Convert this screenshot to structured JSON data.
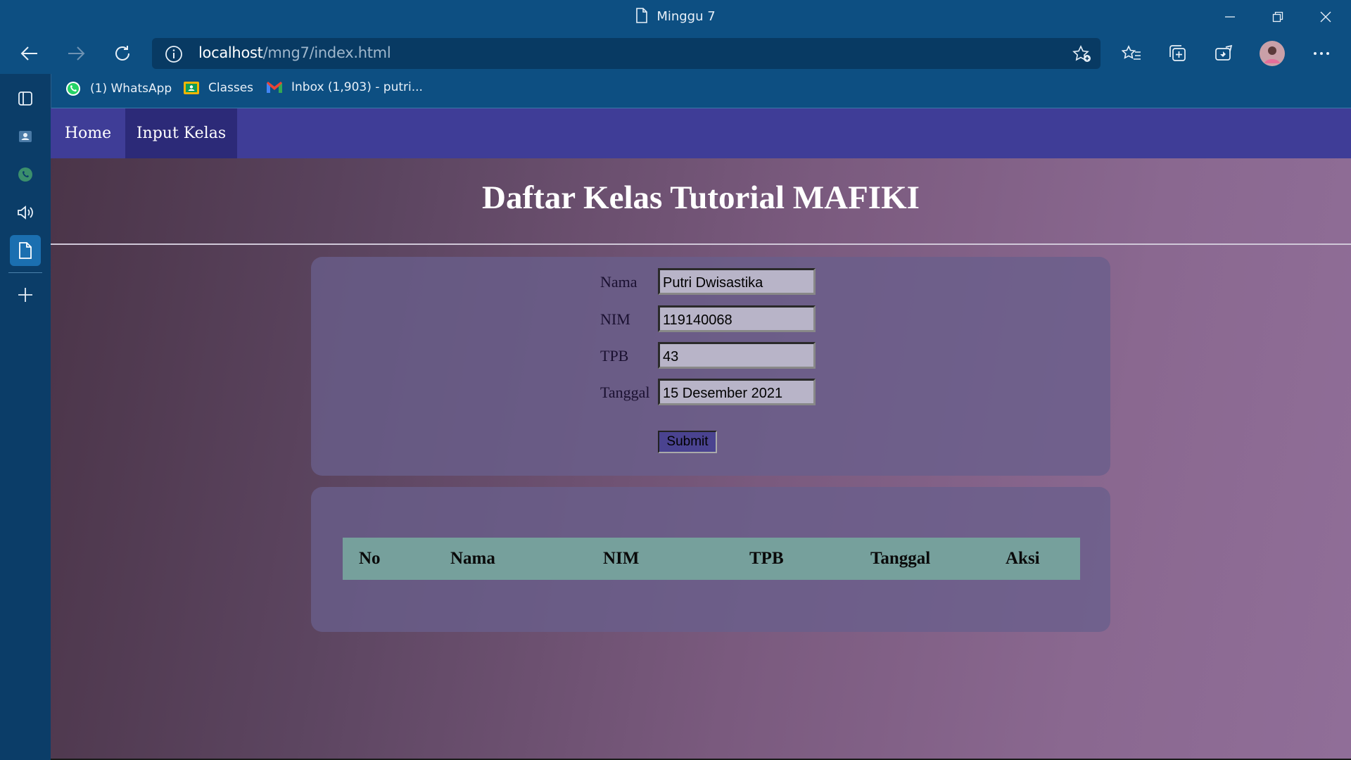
{
  "window": {
    "title": "Minggu 7"
  },
  "browser": {
    "url_host": "localhost",
    "url_path": "/mng7/index.html",
    "bookmarks": [
      {
        "label": "(1) WhatsApp",
        "icon": "whatsapp-icon"
      },
      {
        "label": "Classes",
        "icon": "classroom-icon"
      },
      {
        "label": "Inbox (1,903) - putri...",
        "icon": "gmail-icon"
      }
    ]
  },
  "nav": {
    "items": [
      {
        "label": "Home"
      },
      {
        "label": "Input Kelas"
      }
    ]
  },
  "page": {
    "title": "Daftar Kelas Tutorial MAFIKI"
  },
  "form": {
    "fields": [
      {
        "label": "Nama",
        "value": "Putri Dwisastika"
      },
      {
        "label": "NIM",
        "value": "119140068"
      },
      {
        "label": "TPB",
        "value": "43"
      },
      {
        "label": "Tanggal",
        "value": "15 Desember 2021"
      }
    ],
    "submit_label": "Submit"
  },
  "table": {
    "columns": [
      "No",
      "Nama",
      "NIM",
      "TPB",
      "Tanggal",
      "Aksi"
    ]
  },
  "colors": {
    "titlebar": "#0d4f82",
    "nav_bar": "#3f3d97",
    "nav_active": "#2c2a78",
    "table_header": "#76a09c"
  }
}
